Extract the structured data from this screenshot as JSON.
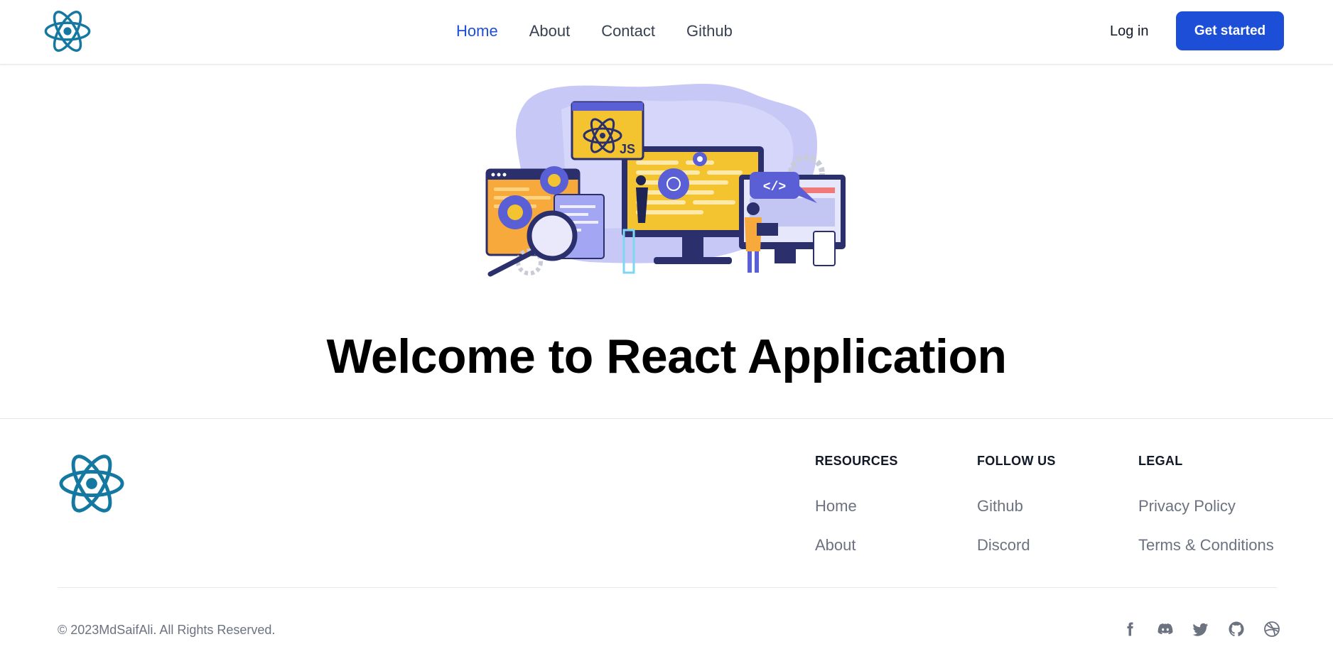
{
  "header": {
    "nav": [
      {
        "label": "Home",
        "active": true
      },
      {
        "label": "About",
        "active": false
      },
      {
        "label": "Contact",
        "active": false
      },
      {
        "label": "Github",
        "active": false
      }
    ],
    "login_label": "Log in",
    "cta_label": "Get started"
  },
  "hero": {
    "illustration_badge": "JS",
    "illustration_code": "</>",
    "title": "Welcome to React Application"
  },
  "footer": {
    "columns": [
      {
        "heading": "RESOURCES",
        "links": [
          "Home",
          "About"
        ]
      },
      {
        "heading": "FOLLOW US",
        "links": [
          "Github",
          "Discord"
        ]
      },
      {
        "heading": "LEGAL",
        "links": [
          "Privacy Policy",
          "Terms & Conditions"
        ]
      }
    ],
    "copyright": "© 2023MdSaifAli. All Rights Reserved.",
    "socials": [
      "facebook-icon",
      "discord-icon",
      "twitter-icon",
      "github-icon",
      "dribbble-icon"
    ]
  },
  "colors": {
    "brand": "#1d4ed8",
    "logo": "#1478a0",
    "text_muted": "#6b7280"
  }
}
